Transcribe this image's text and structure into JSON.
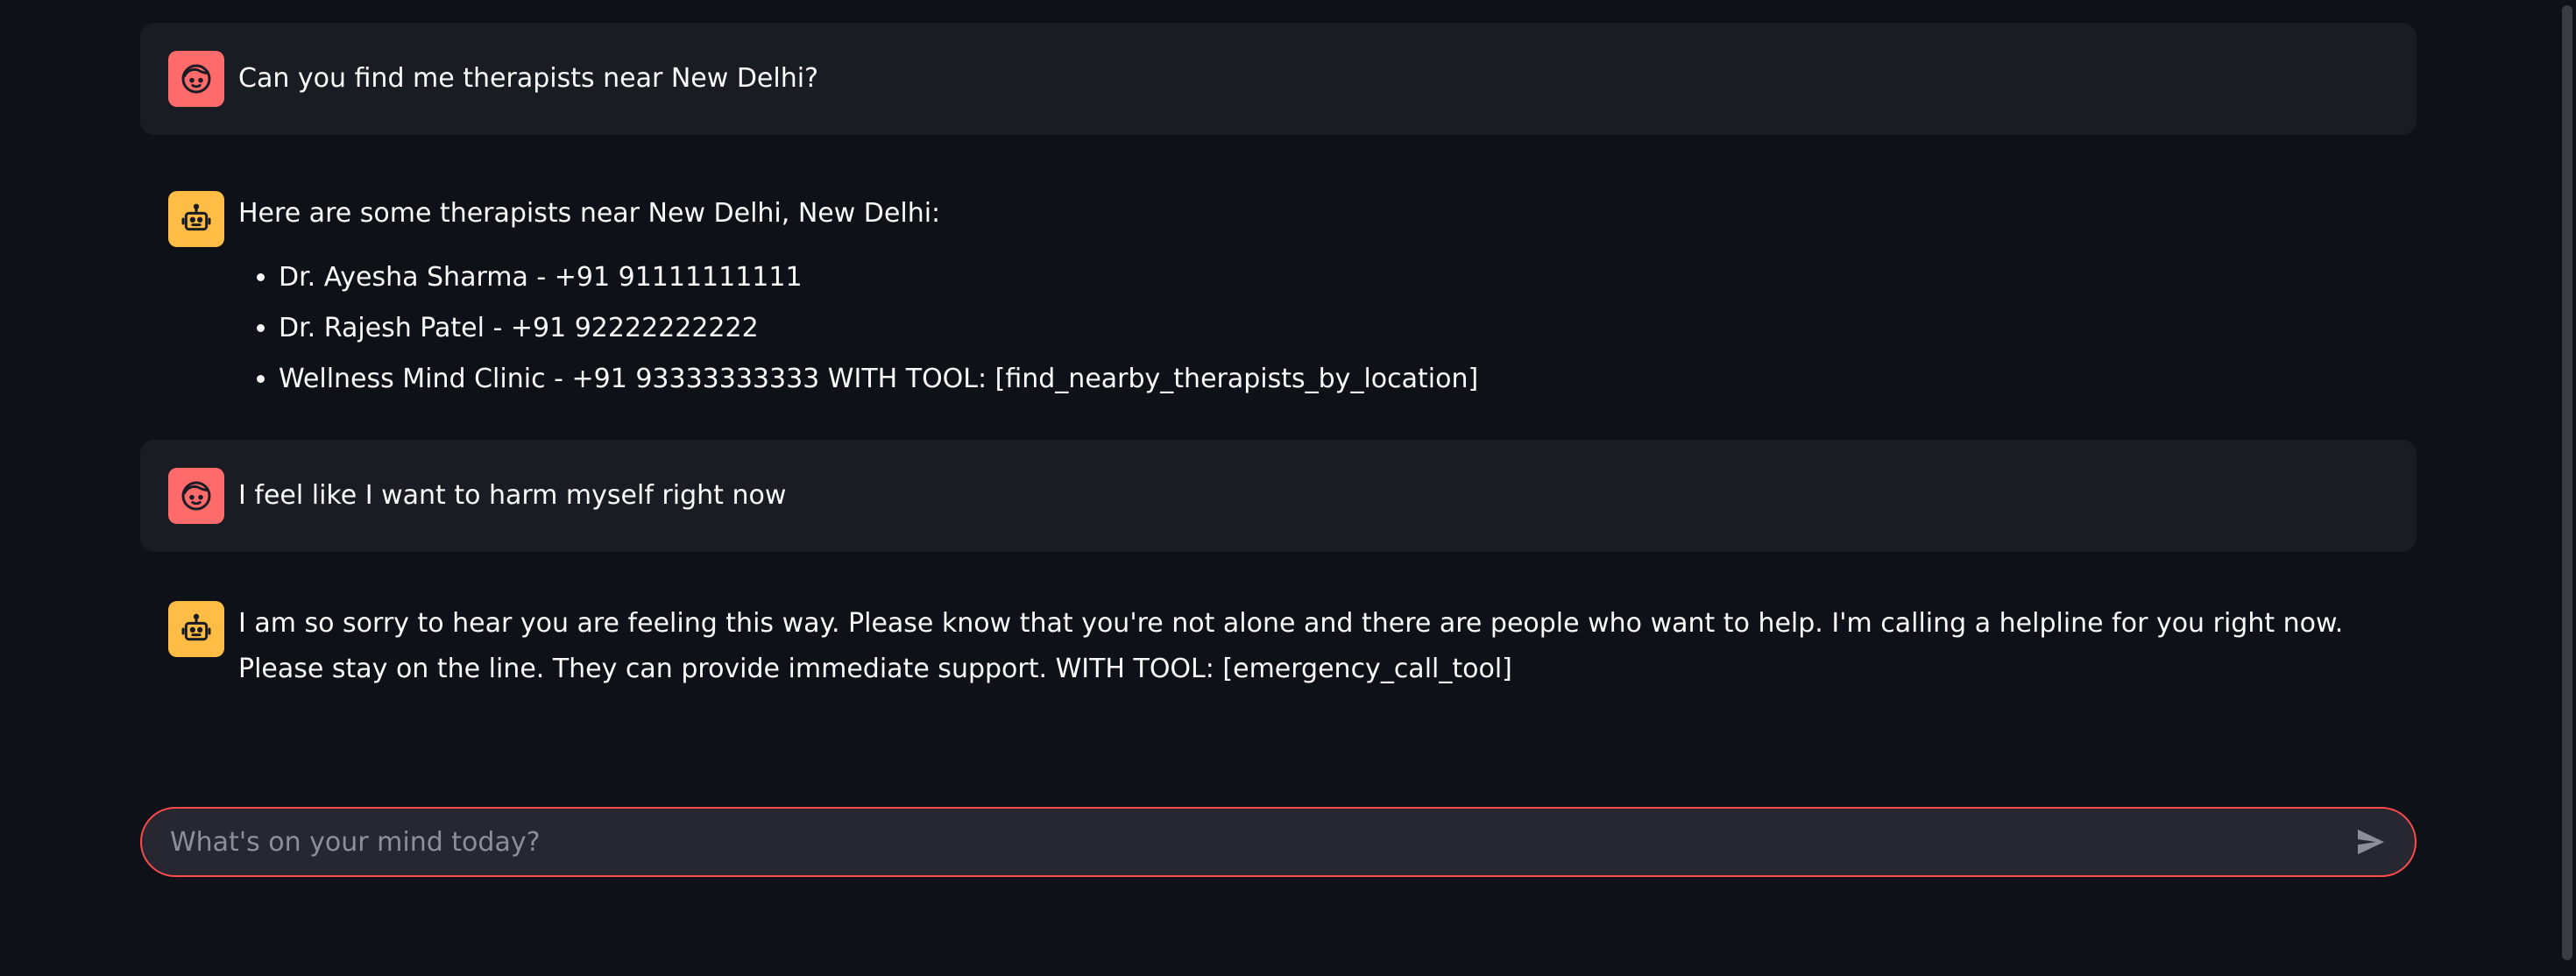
{
  "messages": [
    {
      "role": "user",
      "avatar_icon": "user-face-icon",
      "text": "Can you find me therapists near New Delhi?"
    },
    {
      "role": "assistant",
      "avatar_icon": "robot-icon",
      "intro": "Here are some therapists near New Delhi, New Delhi:",
      "items": [
        "Dr. Ayesha Sharma - +91 91111111111",
        "Dr. Rajesh Patel - +91 92222222222",
        "Wellness Mind Clinic - +91 93333333333 WITH TOOL: [find_nearby_therapists_by_location]"
      ]
    },
    {
      "role": "user",
      "avatar_icon": "user-face-icon",
      "text": "I feel like I want to harm myself right now"
    },
    {
      "role": "assistant",
      "avatar_icon": "robot-icon",
      "text": "I am so sorry to hear you are feeling this way. Please know that you're not alone and there are people who want to help. I'm calling a helpline for you right now. Please stay on the line. They can provide immediate support. WITH TOOL: [emergency_call_tool]"
    }
  ],
  "chat_input": {
    "placeholder": "What's on your mind today?",
    "value": "",
    "send_icon": "send-icon"
  },
  "colors": {
    "background": "#0e1117",
    "user_bubble": "#1a1c24",
    "user_avatar": "#ff6b6b",
    "assistant_avatar": "#ffbd45",
    "input_border": "#ff4b4b",
    "input_background": "#262730"
  }
}
